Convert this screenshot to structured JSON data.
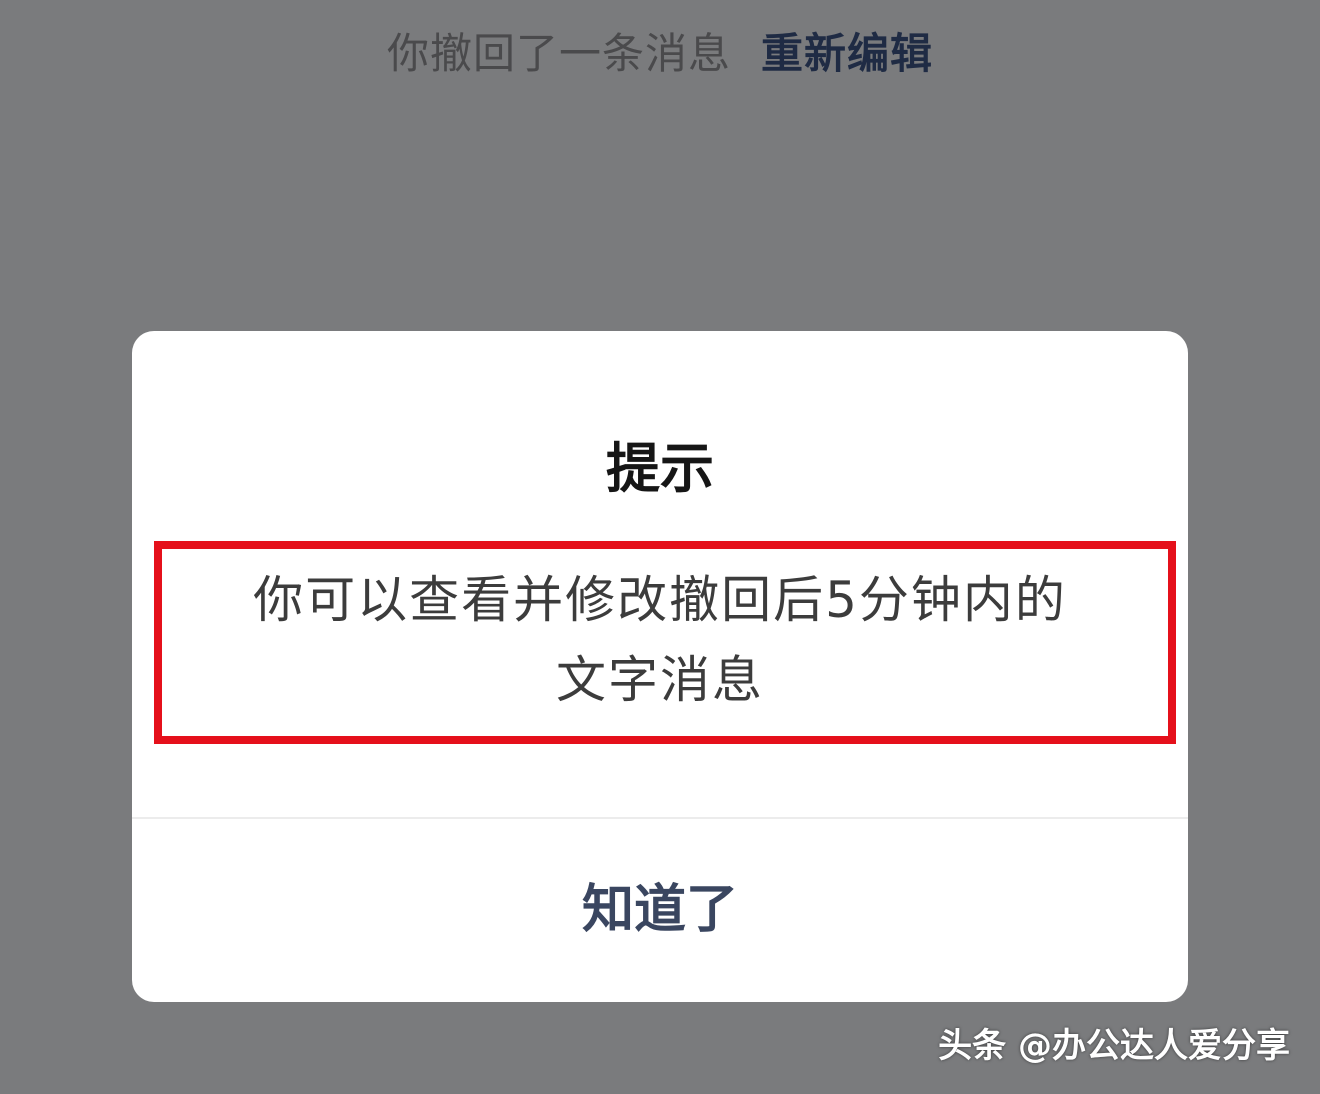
{
  "background_chat": {
    "recall_notice": "你撤回了一条消息",
    "reedit_link": "重新编辑"
  },
  "dialog": {
    "title": "提示",
    "message_line1": "你可以查看并修改撤回后5分钟内的",
    "message_line2": "文字消息",
    "confirm_label": "知道了"
  },
  "watermark": {
    "text": "头条 @办公达人爱分享"
  },
  "colors": {
    "overlay": "#7a7b7d",
    "highlight_border": "#e5101b",
    "confirm_text": "#3a4660",
    "reedit_link": "#1f2b44"
  }
}
